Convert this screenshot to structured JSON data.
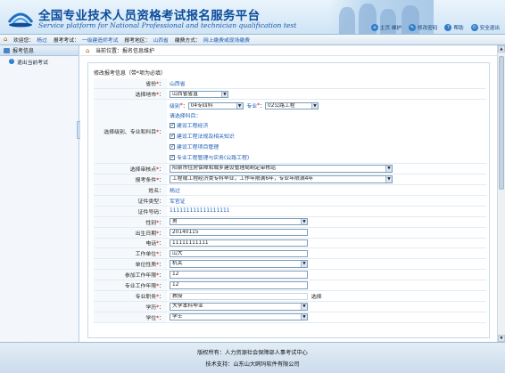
{
  "header": {
    "title_cn": "全国专业技术人员资格考试报名服务平台",
    "title_en": "Service platform for National Professional and technician qualification test",
    "links": [
      {
        "label": "主页 维护",
        "icon": "home-icon"
      },
      {
        "label": "修改密码",
        "icon": "key-icon"
      },
      {
        "label": "帮助",
        "icon": "help-icon"
      },
      {
        "label": "安全退出",
        "icon": "power-icon"
      }
    ]
  },
  "infobar": {
    "welcome_label": "欢迎您：",
    "welcome_value": "杨过",
    "exam_label": "报考考试：",
    "exam_value": "一级建造师考试",
    "area_label": "报考地区：",
    "area_value": "山西省",
    "pay_label": "缴费方式：",
    "pay_value": "网上缴费或现场缴费"
  },
  "sidebar": {
    "head": "报考信息",
    "items": [
      {
        "label": "退出当前考试"
      }
    ]
  },
  "content": {
    "location": "当前位置：报名信息维护",
    "form_title": "修改报考信息（带*项为必填）",
    "rows": {
      "province": {
        "label": "省份",
        "value": "山西省"
      },
      "city": {
        "label": "选择地市",
        "value": "山西省省直"
      },
      "subject": {
        "label": "选择级别、专业和科目",
        "level_label": "级别",
        "level_value": "04专四科",
        "major_label": "专业",
        "major_value": "02公路工程",
        "hint": "请选择科目：",
        "subjects": [
          "建设工程经济",
          "建设工程法规及相关知识",
          "建设工程项目管理",
          "专业工程管理与实务(公路工程)"
        ]
      },
      "site": {
        "label": "选择审核点",
        "value": "阳泉市住房保障和城乡建设管理局制定审核站"
      },
      "condition": {
        "label": "报考条件",
        "value": "工程或工程经济类专科毕业，工作年限满6年，专业年限满4年"
      },
      "name": {
        "label": "姓名",
        "value": "杨过"
      },
      "id_type": {
        "label": "证件类型",
        "value": "军官证"
      },
      "id_no": {
        "label": "证件号码",
        "value": "111111111111111111"
      },
      "gender": {
        "label": "性别",
        "value": "男"
      },
      "birth": {
        "label": "出生日期",
        "value": "20140115"
      },
      "phone": {
        "label": "电话",
        "value": "11111111111"
      },
      "employer": {
        "label": "工作单位",
        "value": "山大"
      },
      "unit_type": {
        "label": "单位性质",
        "value": "机关"
      },
      "work_years": {
        "label": "参加工作年限",
        "value": "12"
      },
      "pro_years": {
        "label": "专业工作年限",
        "value": "12"
      },
      "title": {
        "label": "专业职务",
        "value": "教授",
        "action": "选择"
      },
      "edu": {
        "label": "学历",
        "value": "大学本科毕业"
      },
      "degree": {
        "label": "学位",
        "value": "学士"
      }
    }
  },
  "footer": {
    "line1": "版权所有：人力资源社会保障部人事考试中心",
    "line2": "技术支持：山东山大鸥玛软件有限公司"
  },
  "colors": {
    "brand_blue": "#0d4d9b",
    "link_blue": "#1a5db4",
    "required_red": "#d40000"
  }
}
